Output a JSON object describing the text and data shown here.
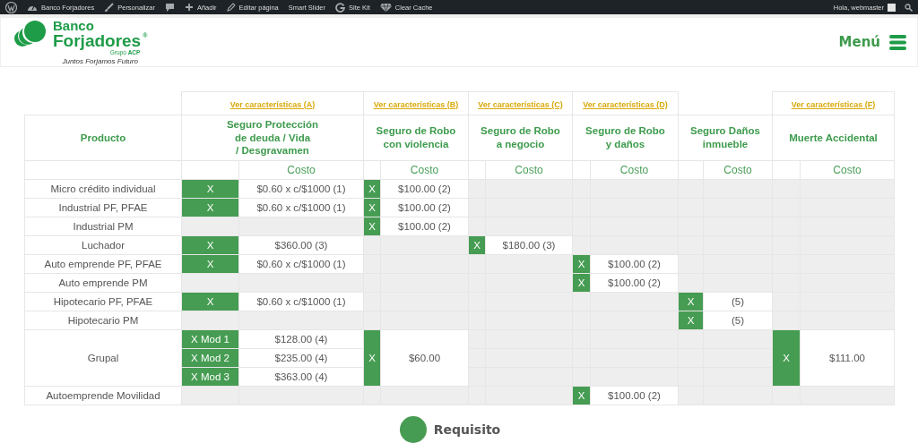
{
  "admin_bar": {
    "items": [
      {
        "kind": "wordpress"
      },
      {
        "kind": "dashboard",
        "label": "Banco Forjadores"
      },
      {
        "kind": "brush",
        "label": "Personalizar"
      },
      {
        "kind": "comments"
      },
      {
        "kind": "plus",
        "label": "Añadir"
      },
      {
        "kind": "pencil",
        "label": "Editar página"
      },
      {
        "kind": "plain",
        "label": "Smart Slider"
      },
      {
        "kind": "google",
        "label": "Site Kit"
      },
      {
        "kind": "cache",
        "label": "Clear Cache"
      }
    ],
    "greeting": "Hola, webmaster"
  },
  "header": {
    "logo": {
      "line1": "Banco",
      "line2": "Forjadores",
      "registered": "®",
      "group": "Grupo **ACP**",
      "tagline": "Juntos Forjamos Futuro"
    },
    "menu_label": "Menú"
  },
  "table": {
    "product_header": "Producto",
    "columns": [
      {
        "link": "Ver características (A)",
        "title": "Seguro Protección\nde deuda / Vida\n/ Desgravamen",
        "cost_header": "Costo"
      },
      {
        "link": "Ver características (B)",
        "title": "Seguro de Robo\ncon violencia",
        "cost_header": "Costo"
      },
      {
        "link": "Ver características (C)",
        "title": "Seguro de Robo\na negocio",
        "cost_header": "Costo"
      },
      {
        "link": "Ver características (D)",
        "title": "Seguro de Robo\ny daños",
        "cost_header": "Costo"
      },
      {
        "title": "Seguro Daños\ninmueble",
        "cost_header": "Costo"
      },
      {
        "link": "Ver características (F)",
        "title": "Muerte Accidental",
        "cost_header": "Costo"
      }
    ],
    "rows": [
      {
        "product": "Micro crédito individual",
        "cells": [
          {
            "covered": true,
            "mark": "X",
            "cost": "$0.60 x c/$1000 (1)"
          },
          {
            "covered": true,
            "mark": "X",
            "cost": "$100.00 (2)"
          },
          {
            "covered": false
          },
          {
            "covered": false
          },
          {
            "covered": false
          },
          {
            "covered": false
          }
        ]
      },
      {
        "product": "Industrial PF, PFAE",
        "cells": [
          {
            "covered": true,
            "mark": "X",
            "cost": "$0.60 x c/$1000 (1)"
          },
          {
            "covered": true,
            "mark": "X",
            "cost": "$100.00 (2)"
          },
          {
            "covered": false
          },
          {
            "covered": false
          },
          {
            "covered": false
          },
          {
            "covered": false
          }
        ]
      },
      {
        "product": "Industrial PM",
        "cells": [
          {
            "covered": false
          },
          {
            "covered": true,
            "mark": "X",
            "cost": "$100.00 (2)"
          },
          {
            "covered": false
          },
          {
            "covered": false
          },
          {
            "covered": false
          },
          {
            "covered": false
          }
        ]
      },
      {
        "product": "Luchador",
        "cells": [
          {
            "covered": true,
            "mark": "X",
            "cost": "$360.00 (3)"
          },
          {
            "covered": false
          },
          {
            "covered": true,
            "mark": "X",
            "cost": "$180.00 (3)"
          },
          {
            "covered": false
          },
          {
            "covered": false
          },
          {
            "covered": false
          }
        ]
      },
      {
        "product": "Auto emprende PF, PFAE",
        "cells": [
          {
            "covered": true,
            "mark": "X",
            "cost": "$0.60 x c/$1000 (1)"
          },
          {
            "covered": false
          },
          {
            "covered": false
          },
          {
            "covered": true,
            "mark": "X",
            "cost": "$100.00 (2)"
          },
          {
            "covered": false
          },
          {
            "covered": false
          }
        ]
      },
      {
        "product": "Auto emprende PM",
        "cells": [
          {
            "covered": false
          },
          {
            "covered": false
          },
          {
            "covered": false
          },
          {
            "covered": true,
            "mark": "X",
            "cost": "$100.00 (2)"
          },
          {
            "covered": false
          },
          {
            "covered": false
          }
        ]
      },
      {
        "product": "Hipotecario PF, PFAE",
        "cells": [
          {
            "covered": true,
            "mark": "X",
            "cost": "$0.60 x c/$1000 (1)"
          },
          {
            "covered": false
          },
          {
            "covered": false
          },
          {
            "covered": false
          },
          {
            "covered": true,
            "mark": "X",
            "cost": "(5)"
          },
          {
            "covered": false
          }
        ]
      },
      {
        "product": "Hipotecario PM",
        "cells": [
          {
            "covered": false
          },
          {
            "covered": false
          },
          {
            "covered": false
          },
          {
            "covered": false
          },
          {
            "covered": true,
            "mark": "X",
            "cost": "(5)"
          },
          {
            "covered": false
          }
        ]
      },
      {
        "product": "Grupal",
        "cells": [
          {
            "covered": true,
            "tiers": [
              {
                "mark": "X Mod 1",
                "cost": "$128.00 (4)"
              },
              {
                "mark": "X Mod 2",
                "cost": "$235.00 (4)"
              },
              {
                "mark": "X Mod 3",
                "cost": "$363.00 (4)"
              }
            ]
          },
          {
            "covered": true,
            "mark": "X",
            "cost": "$60.00"
          },
          {
            "covered": false
          },
          {
            "covered": false
          },
          {
            "covered": false
          },
          {
            "covered": true,
            "mark": "X",
            "cost": "$111.00"
          }
        ]
      },
      {
        "product": "Autoemprende Movilidad",
        "cells": [
          {
            "covered": false
          },
          {
            "covered": false
          },
          {
            "covered": false
          },
          {
            "covered": true,
            "mark": "X",
            "cost": "$100.00 (2)"
          },
          {
            "covered": false
          },
          {
            "covered": false
          }
        ]
      }
    ]
  },
  "legend": {
    "label": "Requisito"
  }
}
